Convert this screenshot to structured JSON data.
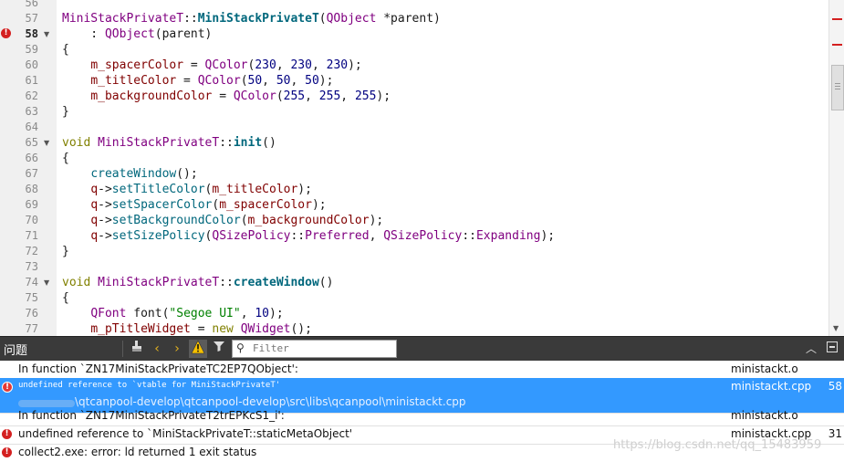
{
  "editor": {
    "lines": [
      {
        "n": "56",
        "code": ""
      },
      {
        "n": "57",
        "code": "<span class='t'>MiniStackPrivateT</span>::<span class='fd'>MiniStackPrivateT</span>(<span class='t'>QObject</span> *parent)"
      },
      {
        "n": "58",
        "code": "    : <span class='t'>QObject</span>(parent)",
        "current": true,
        "error": true,
        "fold": true
      },
      {
        "n": "59",
        "code": "{"
      },
      {
        "n": "60",
        "code": "    <span class='m'>m_spacerColor</span> = <span class='t'>QColor</span>(<span class='n'>230</span>, <span class='n'>230</span>, <span class='n'>230</span>);"
      },
      {
        "n": "61",
        "code": "    <span class='m'>m_titleColor</span> = <span class='t'>QColor</span>(<span class='n'>50</span>, <span class='n'>50</span>, <span class='n'>50</span>);"
      },
      {
        "n": "62",
        "code": "    <span class='m'>m_backgroundColor</span> = <span class='t'>QColor</span>(<span class='n'>255</span>, <span class='n'>255</span>, <span class='n'>255</span>);"
      },
      {
        "n": "63",
        "code": "}"
      },
      {
        "n": "64",
        "code": ""
      },
      {
        "n": "65",
        "code": "<span class='k'>void</span> <span class='t'>MiniStackPrivateT</span>::<span class='fd'>init</span>()",
        "fold": true
      },
      {
        "n": "66",
        "code": "{"
      },
      {
        "n": "67",
        "code": "    <span class='f'>createWindow</span>();"
      },
      {
        "n": "68",
        "code": "    <span class='m'>q</span>-><span class='f'>setTitleColor</span>(<span class='m'>m_titleColor</span>);"
      },
      {
        "n": "69",
        "code": "    <span class='m'>q</span>-><span class='f'>setSpacerColor</span>(<span class='m'>m_spacerColor</span>);"
      },
      {
        "n": "70",
        "code": "    <span class='m'>q</span>-><span class='f'>setBackgroundColor</span>(<span class='m'>m_backgroundColor</span>);"
      },
      {
        "n": "71",
        "code": "    <span class='m'>q</span>-><span class='f'>setSizePolicy</span>(<span class='t'>QSizePolicy</span>::<span class='e'>Preferred</span>, <span class='t'>QSizePolicy</span>::<span class='e'>Expanding</span>);"
      },
      {
        "n": "72",
        "code": "}"
      },
      {
        "n": "73",
        "code": ""
      },
      {
        "n": "74",
        "code": "<span class='k'>void</span> <span class='t'>MiniStackPrivateT</span>::<span class='fd'>createWindow</span>()",
        "fold": true
      },
      {
        "n": "75",
        "code": "{"
      },
      {
        "n": "76",
        "code": "    <span class='t'>QFont</span> font(<span class='s'>\"Segoe UI\"</span>, <span class='n'>10</span>);"
      },
      {
        "n": "77",
        "code": "    <span class='m'>m_pTitleWidget</span> = <span class='k'>new</span> <span class='t'>QWidget</span>();"
      }
    ]
  },
  "panel": {
    "title": "问题",
    "filter_placeholder": "Filter"
  },
  "issues": [
    {
      "kind": "info",
      "description": "In function `ZN17MiniStackPrivateTC2EP7QObject':",
      "file": "ministackt.o",
      "line": ""
    },
    {
      "kind": "error",
      "selected": true,
      "description": "undefined reference to `vtable for MiniStackPrivateT'",
      "path": "\\qtcanpool-develop\\qtcanpool-develop\\src\\libs\\qcanpool\\ministackt.cpp",
      "file": "ministackt.cpp",
      "line": "58"
    },
    {
      "kind": "info",
      "description": "In function `ZN17MiniStackPrivateT2trEPKcS1_i':",
      "file": "ministackt.o",
      "line": ""
    },
    {
      "kind": "error",
      "description": "undefined reference to `MiniStackPrivateT::staticMetaObject'",
      "file": "ministackt.cpp",
      "line": "31"
    },
    {
      "kind": "error",
      "description": "collect2.exe: error: ld returned 1 exit status",
      "file": "",
      "line": ""
    }
  ],
  "watermark": "https://blog.csdn.net/qq_15483959",
  "colors": {
    "error": "#d42020",
    "selection": "#3399ff",
    "toolbar": "#3a3a3a"
  }
}
